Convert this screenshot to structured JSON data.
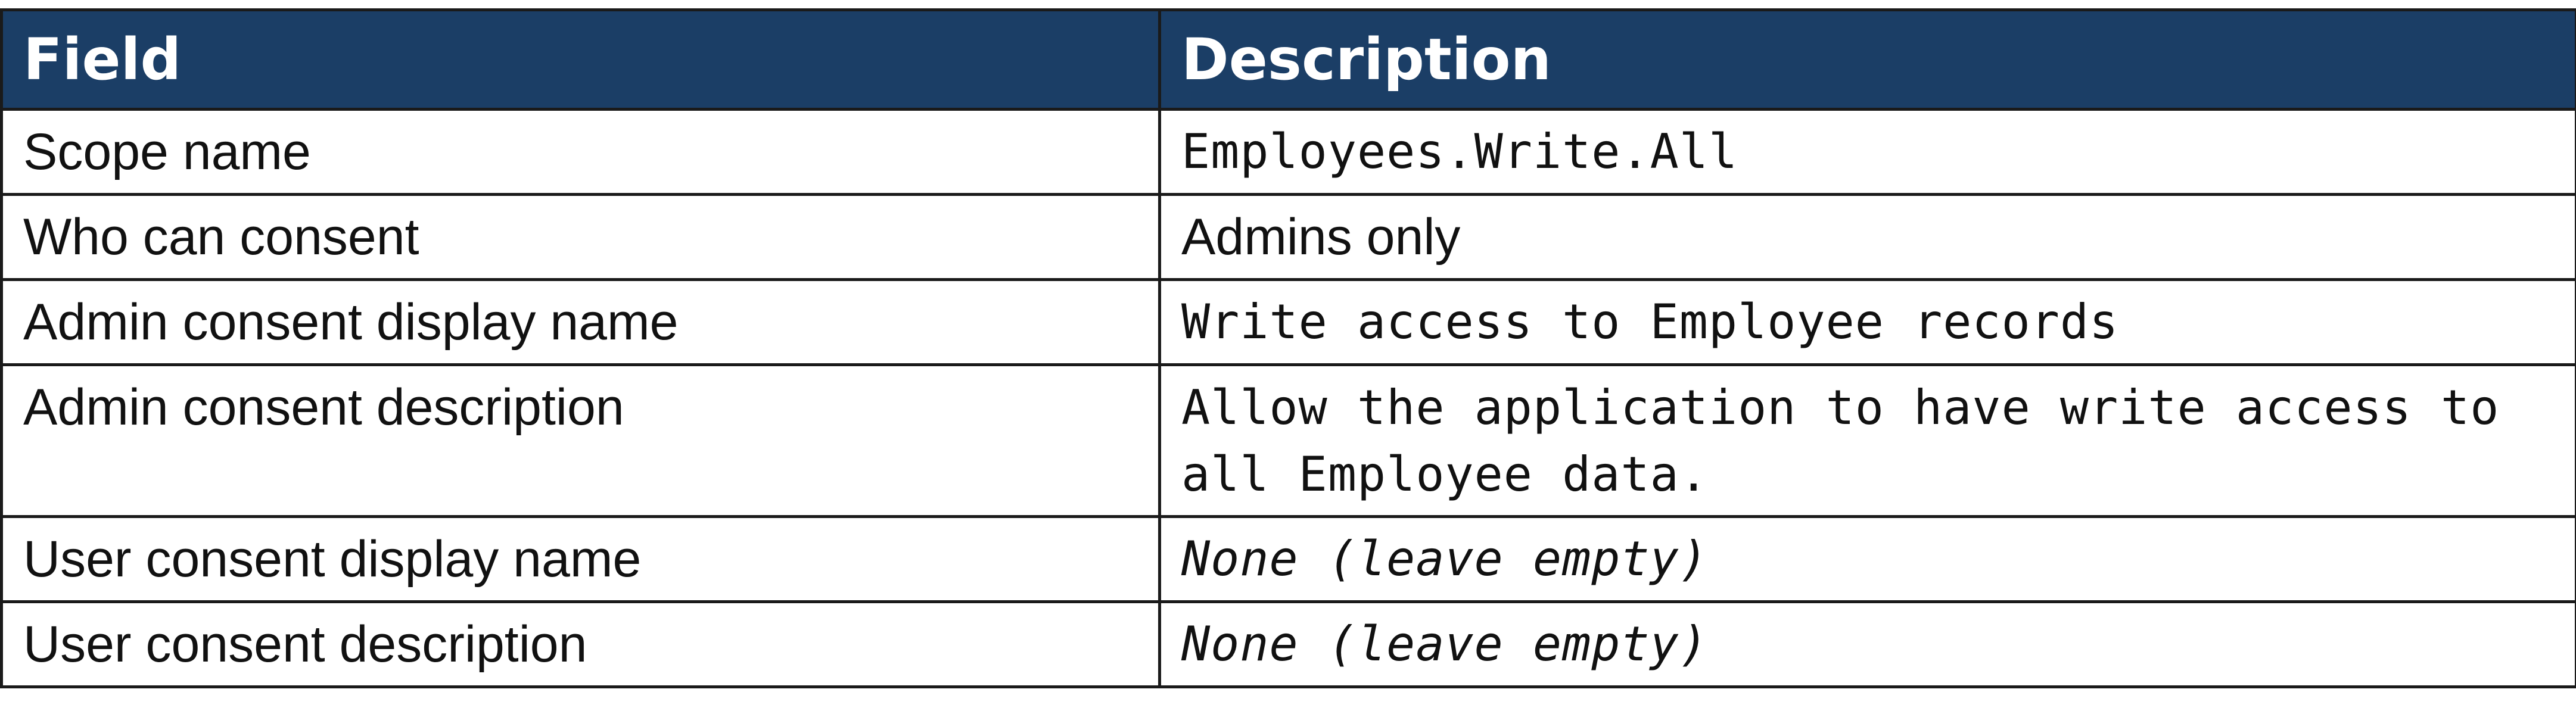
{
  "table": {
    "headers": [
      "Field",
      "Description"
    ],
    "rows": [
      {
        "field": "Scope name",
        "description": "Employees.Write.All",
        "style": "mono"
      },
      {
        "field": "Who can consent",
        "description": "Admins only",
        "style": "normal"
      },
      {
        "field": "Admin consent display name",
        "description": "Write access to Employee records",
        "style": "mono"
      },
      {
        "field": "Admin consent description",
        "description": "Allow the application to have write access to all Employee data.",
        "style": "mono"
      },
      {
        "field": "User consent display name",
        "description": "None (leave empty)",
        "style": "mono-italic"
      },
      {
        "field": "User consent description",
        "description": "None (leave empty)",
        "style": "mono-italic"
      }
    ]
  },
  "colors": {
    "header_bg": "#1b3e66",
    "header_text": "#ffffff",
    "border": "#1a1a1a"
  }
}
